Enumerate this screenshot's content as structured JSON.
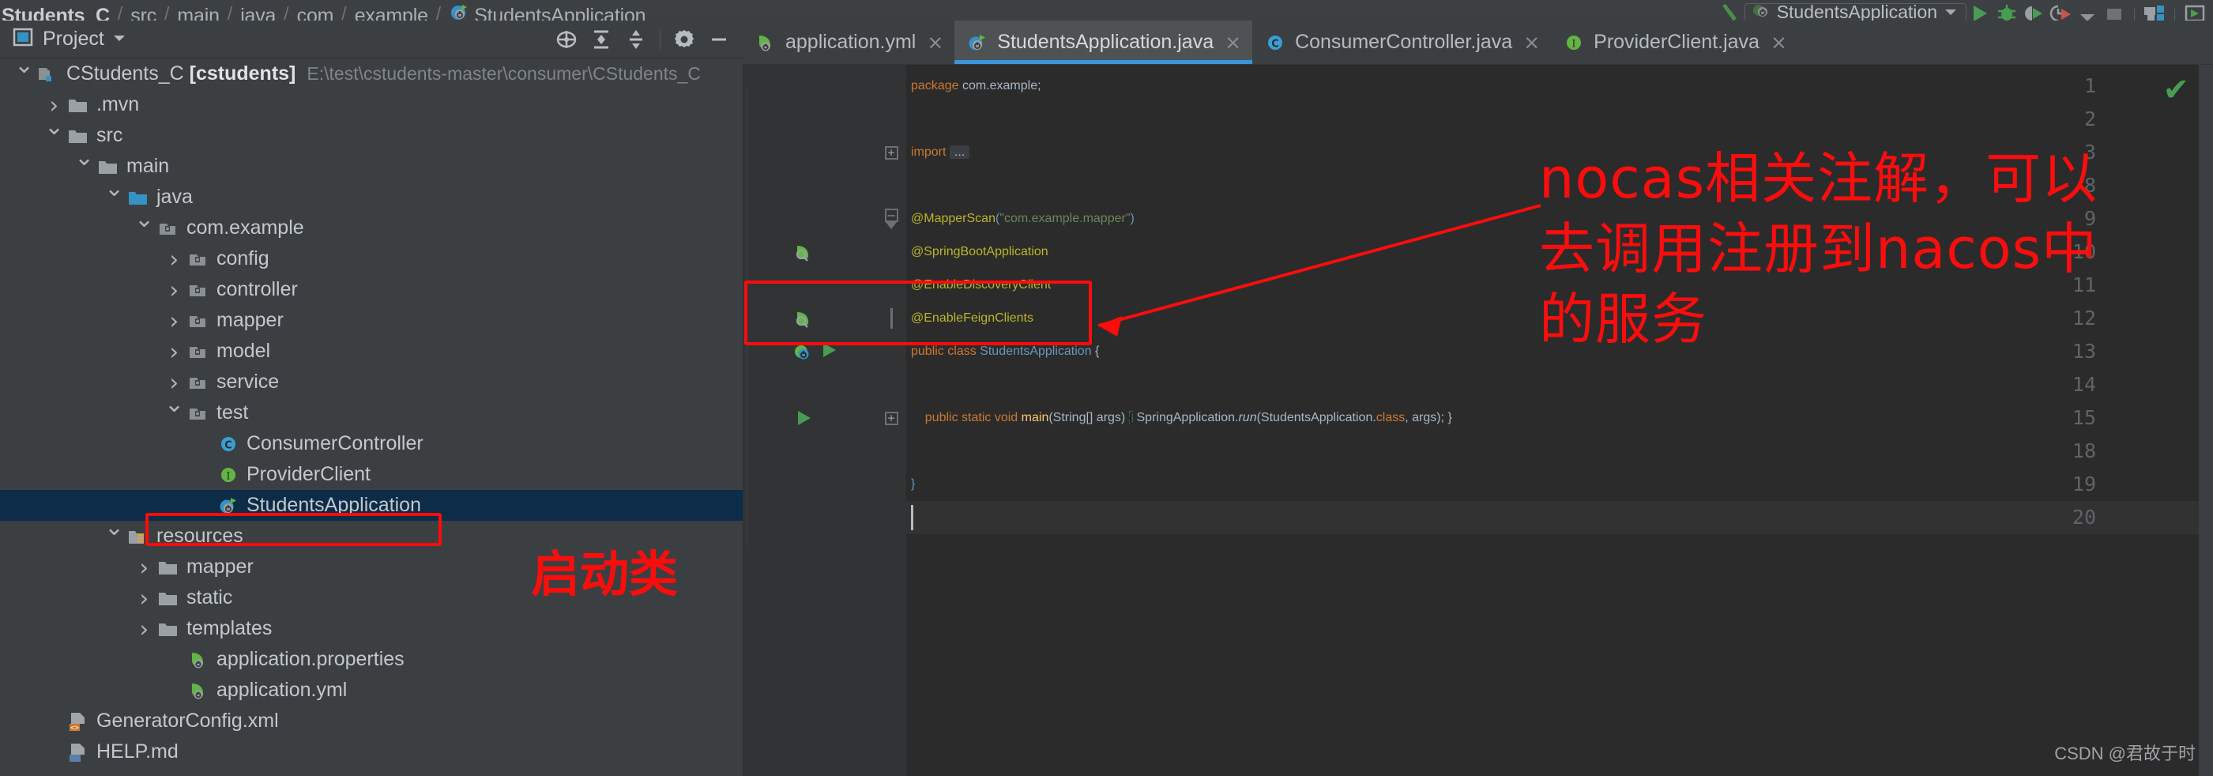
{
  "breadcrumb": {
    "items": [
      {
        "label": "Students_C",
        "bold": true,
        "icon": ""
      },
      {
        "label": "src",
        "bold": false,
        "icon": ""
      },
      {
        "label": "main",
        "bold": false,
        "icon": ""
      },
      {
        "label": "java",
        "bold": false,
        "icon": ""
      },
      {
        "label": "com",
        "bold": false,
        "icon": ""
      },
      {
        "label": "example",
        "bold": false,
        "icon": ""
      },
      {
        "label": "StudentsApplication",
        "bold": false,
        "icon": "spring-boot-class-icon"
      }
    ],
    "separator": "/"
  },
  "run_toolbar": {
    "config_name": "StudentsApplication",
    "config_icon": "spring-boot-run-config-icon",
    "config_dropdown_icon": "chevron-down-icon",
    "buttons": [
      {
        "name": "run-button",
        "icon": "play-icon",
        "color": "#499c54"
      },
      {
        "name": "debug-button",
        "icon": "bug-icon",
        "color": "#499c54"
      },
      {
        "name": "run-with-coverage-button",
        "icon": "coverage-icon",
        "color": "#499c54"
      },
      {
        "name": "profile-button",
        "icon": "profiler-icon",
        "color": "#c75450"
      },
      {
        "name": "more-run-options-button",
        "icon": "chevron-down-icon",
        "color": "#9aa0a4"
      },
      {
        "name": "stop-button",
        "icon": "stop-square-icon",
        "color": "#6e7275"
      },
      {
        "name": "layout-button",
        "icon": "window-layout-icon",
        "color": "#3592c4"
      },
      {
        "name": "run-anything-button",
        "icon": "run-anything-icon",
        "color": "#499c54"
      }
    ]
  },
  "project_panel": {
    "title": "Project",
    "title_icon": "project-icon",
    "dropdown_icon": "chevron-down-icon",
    "tools": [
      {
        "name": "scroll-from-source-button",
        "icon": "locate-target-icon"
      },
      {
        "name": "expand-all-button",
        "icon": "expand-all-icon"
      },
      {
        "name": "collapse-all-button",
        "icon": "collapse-all-icon"
      },
      {
        "name": "settings-button",
        "icon": "gear-icon"
      },
      {
        "name": "hide-panel-button",
        "icon": "minimize-icon"
      }
    ]
  },
  "tree": {
    "nodes": [
      {
        "indent": 0,
        "arrow": "down",
        "icon": "module-icon",
        "label": "CStudents_C",
        "label_bold": " [cstudents]",
        "path": "E:\\test\\cstudents-master\\consumer\\CStudents_C",
        "selected": false
      },
      {
        "indent": 1,
        "arrow": "right",
        "icon": "folder-icon",
        "label": ".mvn",
        "label_bold": "",
        "path": "",
        "selected": false
      },
      {
        "indent": 1,
        "arrow": "down",
        "icon": "folder-icon",
        "label": "src",
        "label_bold": "",
        "path": "",
        "selected": false
      },
      {
        "indent": 2,
        "arrow": "down",
        "icon": "folder-icon",
        "label": "main",
        "label_bold": "",
        "path": "",
        "selected": false
      },
      {
        "indent": 3,
        "arrow": "down",
        "icon": "source-root-icon",
        "label": "java",
        "label_bold": "",
        "path": "",
        "selected": false
      },
      {
        "indent": 4,
        "arrow": "down",
        "icon": "package-icon",
        "label": "com.example",
        "label_bold": "",
        "path": "",
        "selected": false
      },
      {
        "indent": 5,
        "arrow": "right",
        "icon": "package-icon",
        "label": "config",
        "label_bold": "",
        "path": "",
        "selected": false
      },
      {
        "indent": 5,
        "arrow": "right",
        "icon": "package-icon",
        "label": "controller",
        "label_bold": "",
        "path": "",
        "selected": false
      },
      {
        "indent": 5,
        "arrow": "right",
        "icon": "package-icon",
        "label": "mapper",
        "label_bold": "",
        "path": "",
        "selected": false
      },
      {
        "indent": 5,
        "arrow": "right",
        "icon": "package-icon",
        "label": "model",
        "label_bold": "",
        "path": "",
        "selected": false
      },
      {
        "indent": 5,
        "arrow": "right",
        "icon": "package-icon",
        "label": "service",
        "label_bold": "",
        "path": "",
        "selected": false
      },
      {
        "indent": 5,
        "arrow": "down",
        "icon": "package-icon",
        "label": "test",
        "label_bold": "",
        "path": "",
        "selected": false
      },
      {
        "indent": 6,
        "arrow": "none",
        "icon": "java-class-icon",
        "label": "ConsumerController",
        "label_bold": "",
        "path": "",
        "selected": false
      },
      {
        "indent": 6,
        "arrow": "none",
        "icon": "java-interface-icon",
        "label": "ProviderClient",
        "label_bold": "",
        "path": "",
        "selected": false
      },
      {
        "indent": 6,
        "arrow": "none",
        "icon": "spring-boot-class-icon",
        "label": "StudentsApplication",
        "label_bold": "",
        "path": "",
        "selected": true
      },
      {
        "indent": 3,
        "arrow": "down",
        "icon": "resource-root-icon",
        "label": "resources",
        "label_bold": "",
        "path": "",
        "selected": false
      },
      {
        "indent": 4,
        "arrow": "right",
        "icon": "folder-icon",
        "label": "mapper",
        "label_bold": "",
        "path": "",
        "selected": false
      },
      {
        "indent": 4,
        "arrow": "right",
        "icon": "folder-icon",
        "label": "static",
        "label_bold": "",
        "path": "",
        "selected": false
      },
      {
        "indent": 4,
        "arrow": "right",
        "icon": "folder-icon",
        "label": "templates",
        "label_bold": "",
        "path": "",
        "selected": false
      },
      {
        "indent": 5,
        "arrow": "none",
        "icon": "spring-config-icon",
        "label": "application.properties",
        "label_bold": "",
        "path": "",
        "selected": false
      },
      {
        "indent": 5,
        "arrow": "none",
        "icon": "spring-config-icon",
        "label": "application.yml",
        "label_bold": "",
        "path": "",
        "selected": false
      },
      {
        "indent": 1,
        "arrow": "none",
        "icon": "xml-file-icon",
        "label": "GeneratorConfig.xml",
        "label_bold": "",
        "path": "",
        "selected": false
      },
      {
        "indent": 1,
        "arrow": "none",
        "icon": "markdown-file-icon",
        "label": "HELP.md",
        "label_bold": "",
        "path": "",
        "selected": false
      }
    ]
  },
  "editor_tabs": [
    {
      "label": "application.yml",
      "icon": "spring-config-icon",
      "active": false,
      "close_icon": "×"
    },
    {
      "label": "StudentsApplication.java",
      "icon": "spring-boot-class-icon",
      "active": true,
      "close_icon": "×"
    },
    {
      "label": "ConsumerController.java",
      "icon": "java-class-icon",
      "active": false,
      "close_icon": "×"
    },
    {
      "label": "ProviderClient.java",
      "icon": "java-interface-icon",
      "active": false,
      "close_icon": "×"
    }
  ],
  "editor": {
    "inspection_status_icon": "green-checkmark-icon",
    "lines": [
      {
        "num": "1",
        "gutter_icon": "",
        "fold": "",
        "tokens": [
          {
            "t": "package",
            "c": "kw"
          },
          {
            "t": " ",
            "c": "plain"
          },
          {
            "t": "com.example",
            "c": "plain"
          },
          {
            "t": ";",
            "c": "plain"
          }
        ]
      },
      {
        "num": "2",
        "gutter_icon": "",
        "fold": "",
        "tokens": []
      },
      {
        "num": "3",
        "gutter_icon": "",
        "fold": "plus",
        "tokens": [
          {
            "t": "import",
            "c": "kw"
          },
          {
            "t": " ",
            "c": "plain"
          },
          {
            "t": "...",
            "c": "fold-dots"
          }
        ]
      },
      {
        "num": "8",
        "gutter_icon": "",
        "fold": "",
        "tokens": []
      },
      {
        "num": "9",
        "gutter_icon": "",
        "fold": "minus-arrow",
        "tokens": [
          {
            "t": "@MapperScan",
            "c": "ann"
          },
          {
            "t": "(",
            "c": "num"
          },
          {
            "t": "\"com.example.mapper\"",
            "c": "str"
          },
          {
            "t": ")",
            "c": "num"
          }
        ]
      },
      {
        "num": "10",
        "gutter_icon": "spring-bean-icon",
        "fold": "",
        "tokens": [
          {
            "t": "@SpringBootApplication",
            "c": "ann"
          }
        ]
      },
      {
        "num": "11",
        "gutter_icon": "",
        "fold": "",
        "tokens": [
          {
            "t": "@EnableDiscoveryClient",
            "c": "ann"
          }
        ]
      },
      {
        "num": "12",
        "gutter_icon": "spring-bean-icon",
        "fold": "pipe",
        "tokens": [
          {
            "t": "@EnableFeignClients",
            "c": "ann"
          }
        ]
      },
      {
        "num": "13",
        "gutter_icon": "spring-boot-class-run-icon",
        "fold": "",
        "tokens": [
          {
            "t": "public",
            "c": "kw"
          },
          {
            "t": " ",
            "c": "plain"
          },
          {
            "t": "class",
            "c": "kw"
          },
          {
            "t": " ",
            "c": "plain"
          },
          {
            "t": "StudentsApplication",
            "c": "num"
          },
          {
            "t": " {",
            "c": "plain"
          }
        ]
      },
      {
        "num": "14",
        "gutter_icon": "",
        "fold": "",
        "tokens": []
      },
      {
        "num": "15",
        "gutter_icon": "run-method-icon",
        "fold": "plus",
        "tokens": [
          {
            "t": "    ",
            "c": "plain"
          },
          {
            "t": "public",
            "c": "kw"
          },
          {
            "t": " ",
            "c": "plain"
          },
          {
            "t": "static",
            "c": "kw"
          },
          {
            "t": " ",
            "c": "plain"
          },
          {
            "t": "void",
            "c": "kw"
          },
          {
            "t": " ",
            "c": "plain"
          },
          {
            "t": "main",
            "c": "meth"
          },
          {
            "t": "(",
            "c": "plain"
          },
          {
            "t": "String",
            "c": "plain"
          },
          {
            "t": "[] args) ",
            "c": "plain"
          },
          {
            "t": "{",
            "c": "brace-hl"
          },
          {
            "t": " SpringApplication.",
            "c": "plain"
          },
          {
            "t": "run",
            "c": "ital"
          },
          {
            "t": "(StudentsApplication.",
            "c": "plain"
          },
          {
            "t": "class",
            "c": "kw"
          },
          {
            "t": ", args); }",
            "c": "plain"
          }
        ]
      },
      {
        "num": "18",
        "gutter_icon": "",
        "fold": "",
        "tokens": []
      },
      {
        "num": "19",
        "gutter_icon": "",
        "fold": "",
        "tokens": [
          {
            "t": "}",
            "c": "num"
          }
        ]
      },
      {
        "num": "20",
        "gutter_icon": "",
        "fold": "",
        "tokens": [],
        "current": true
      }
    ]
  },
  "annotations": {
    "code_note": "nocas相关注解，可以\n去调用注册到nacos中\n的服务",
    "tree_note": "启动类",
    "arrow_icon": "red-arrow-icon",
    "highlight_color": "#fb0d0d"
  },
  "watermark": "CSDN @君故于时"
}
